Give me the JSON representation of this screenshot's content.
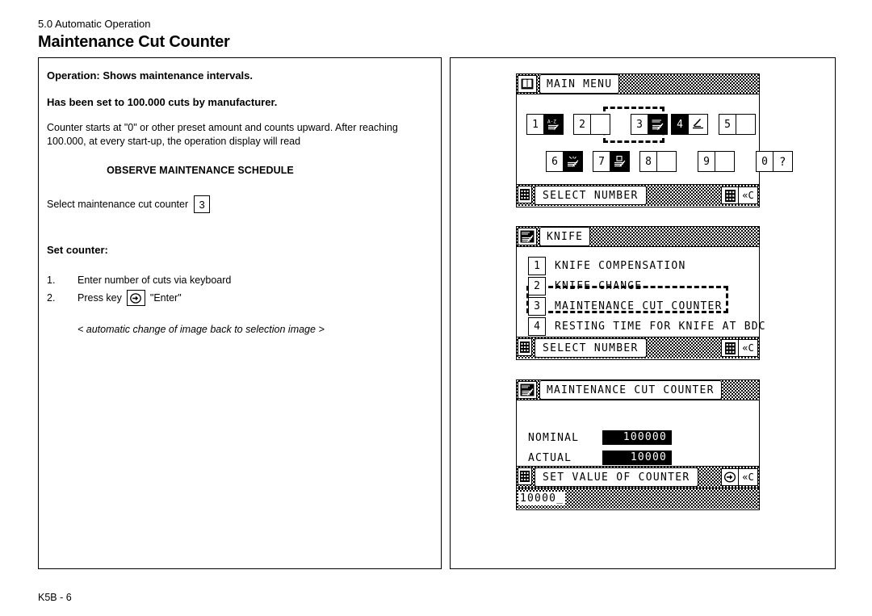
{
  "header": {
    "section": "5.0 Automatic Operation",
    "title": "Maintenance Cut Counter"
  },
  "footer": {
    "page_id": "K5B - 6"
  },
  "left": {
    "operation_line": "Operation:  Shows maintenance intervals.",
    "factory_line": "Has been set to 100.000 cuts by manufacturer.",
    "description": "Counter starts at \"0\" or other preset amount and counts upward. After reaching 100.000, at every start-up, the operation display will read",
    "display_message": "OBSERVE MAINTENANCE SCHEDULE",
    "select_label": "Select maintenance cut counter",
    "select_value": "3",
    "set_counter_title": "Set counter:",
    "steps": [
      {
        "num": "1.",
        "text": "Enter number of cuts via keyboard"
      },
      {
        "num": "2.",
        "text_before": "Press key",
        "key_icon": "enter-arrow-icon",
        "text_after": "\"Enter\""
      }
    ],
    "note": "< automatic change of image back to selection image >"
  },
  "panels": {
    "main_menu": {
      "title": "MAIN MENU",
      "title_icon": "open-book-icon",
      "status": "SELECT NUMBER",
      "status_icons": [
        "keypad-icon",
        "back-clear-icon"
      ],
      "row1": [
        {
          "num": "1",
          "icon": "sort-az-icon",
          "inverted": true
        },
        {
          "num": "2",
          "icon": "blank-icon",
          "inverted": false
        },
        {
          "num": "3",
          "icon": "knife-icon",
          "inverted": true
        },
        {
          "num": "4",
          "icon": "wrench-icon",
          "inverted": true
        },
        {
          "num": "5",
          "icon": "blank-icon",
          "inverted": false
        }
      ],
      "row2": [
        {
          "num": "6",
          "icon": "stack-cut-icon",
          "inverted": true
        },
        {
          "num": "7",
          "icon": "stack-pages-icon",
          "inverted": true
        },
        {
          "num": "8",
          "icon": "blank-icon",
          "inverted": false
        },
        {
          "num": "9",
          "icon": "blank-icon",
          "inverted": false
        },
        {
          "num": "0",
          "icon": "question-icon",
          "inverted": false
        }
      ],
      "selected": "3"
    },
    "knife": {
      "title": "KNIFE",
      "title_icon": "knife-icon",
      "status": "SELECT NUMBER",
      "status_icons": [
        "keypad-icon",
        "back-clear-icon"
      ],
      "items": [
        {
          "num": "1",
          "label": "KNIFE COMPENSATION"
        },
        {
          "num": "2",
          "label": "KNIFE CHANGE"
        },
        {
          "num": "3",
          "label": "MAINTENANCE CUT COUNTER"
        },
        {
          "num": "4",
          "label": "RESTING TIME FOR KNIFE AT BDC"
        }
      ],
      "selected": "3"
    },
    "maintenance": {
      "title": "MAINTENANCE CUT COUNTER",
      "title_icon": "knife-icon",
      "nominal_label": "NOMINAL",
      "nominal_value": "100000",
      "actual_label": "ACTUAL",
      "actual_value": "10000",
      "status": "SET VALUE OF COUNTER",
      "status_icons": [
        "keypad-icon",
        "enter-arrow-icon",
        "back-clear-icon"
      ],
      "input_value": "10000_"
    }
  }
}
